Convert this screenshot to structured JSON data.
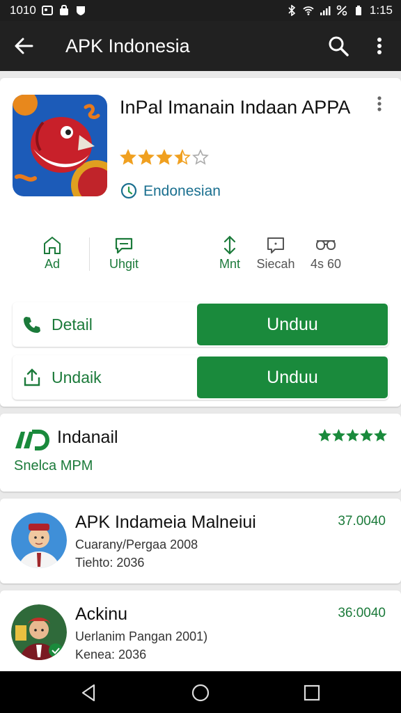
{
  "status": {
    "time_left": "1010",
    "time_right": "1:15"
  },
  "appbar": {
    "title": "APK Indonesia"
  },
  "app": {
    "title": "InPal Imanain Indaan APPA",
    "rating": 3.5,
    "language": "Endonesian"
  },
  "stats": [
    {
      "label": "Ad",
      "icon": "home-icon"
    },
    {
      "label": "Uhgit",
      "icon": "chat-bubble-icon"
    },
    {
      "label": "Mnt",
      "icon": "download-arrows-icon"
    },
    {
      "label": "Siecah",
      "icon": "message-icon"
    },
    {
      "label": "4s 60",
      "icon": "glasses-icon"
    }
  ],
  "actions": [
    {
      "label": "Detail",
      "button": "Unduu",
      "icon": "phone-icon"
    },
    {
      "label": "Undaik",
      "button": "Unduu",
      "icon": "share-icon"
    }
  ],
  "developer": {
    "name": "Indanail",
    "subtitle": "Snelca MPM",
    "rating": 5
  },
  "list": [
    {
      "title": "APK Indameia Malneiui",
      "line1": "Cuarany/Pergaa 2008",
      "line2": "Tiehto: 2036",
      "price": "37.0040"
    },
    {
      "title": "Ackinu",
      "line1": "Uerlanim Pangan 2001)",
      "line2": "Kenea: 2036",
      "price": "36:0040"
    }
  ],
  "colors": {
    "green": "#1a8a3c",
    "appbar": "#212121",
    "star": "#f0a020"
  }
}
